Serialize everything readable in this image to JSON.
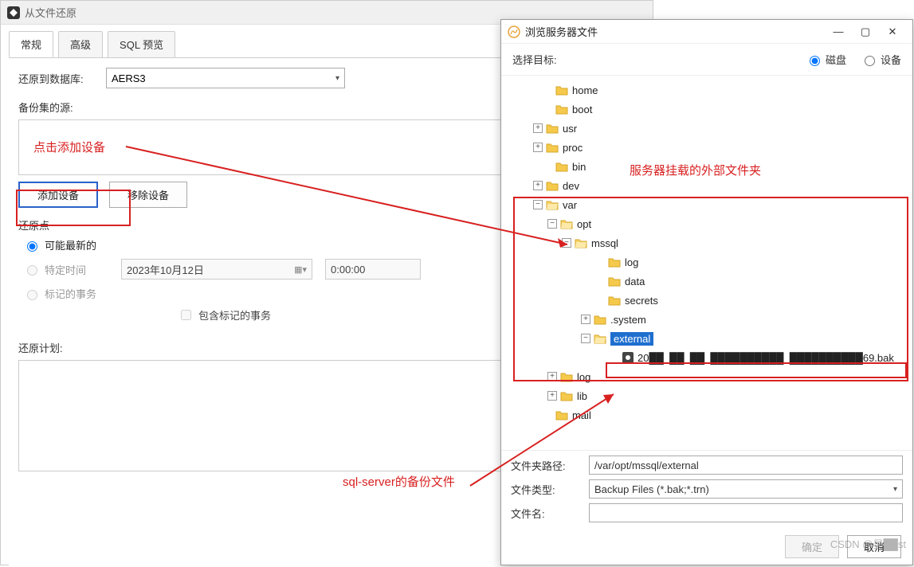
{
  "main": {
    "title": "从文件还原",
    "tabs": {
      "general": "常规",
      "advanced": "高级",
      "sql_preview": "SQL 预览"
    },
    "restore_to_db_label": "还原到数据库:",
    "restore_to_db_value": "AERS3",
    "backup_source_label": "备份集的源:",
    "add_device_btn": "添加设备",
    "remove_device_btn": "移除设备",
    "restore_point_label": "还原点",
    "radio_latest": "可能最新的",
    "radio_specific_time": "特定时间",
    "radio_marked_txn": "标记的事务",
    "date_value": "2023年10月12日",
    "time_value": "0:00:00",
    "include_marked_txn": "包含标记的事务",
    "restore_plan_label": "还原计划:"
  },
  "browse": {
    "title": "浏览服务器文件",
    "select_target_label": "选择目标:",
    "radio_disk": "磁盘",
    "radio_device": "设备",
    "tree": {
      "home": "home",
      "boot": "boot",
      "usr": "usr",
      "proc": "proc",
      "bin": "bin",
      "dev": "dev",
      "var": "var",
      "opt": "opt",
      "mssql": "mssql",
      "log": "log",
      "data": "data",
      "secrets": "secrets",
      "system": ".system",
      "external": "external",
      "bakfile": "20██_██_██_██████████_██████████69.bak",
      "varlog": "log",
      "lib": "lib",
      "mail": "mail"
    },
    "folder_path_label": "文件夹路径:",
    "folder_path_value": "/var/opt/mssql/external",
    "file_type_label": "文件类型:",
    "file_type_value": "Backup Files (*.bak;*.trn)",
    "file_name_label": "文件名:",
    "file_name_value": "",
    "ok_btn": "确定",
    "cancel_btn": "取消"
  },
  "annotations": {
    "click_add_device": "点击添加设备",
    "server_mounted_folder": "服务器挂载的外部文件夹",
    "sql_server_backup_file": "sql-server的备份文件"
  },
  "watermark": "CSDN @吴██st"
}
